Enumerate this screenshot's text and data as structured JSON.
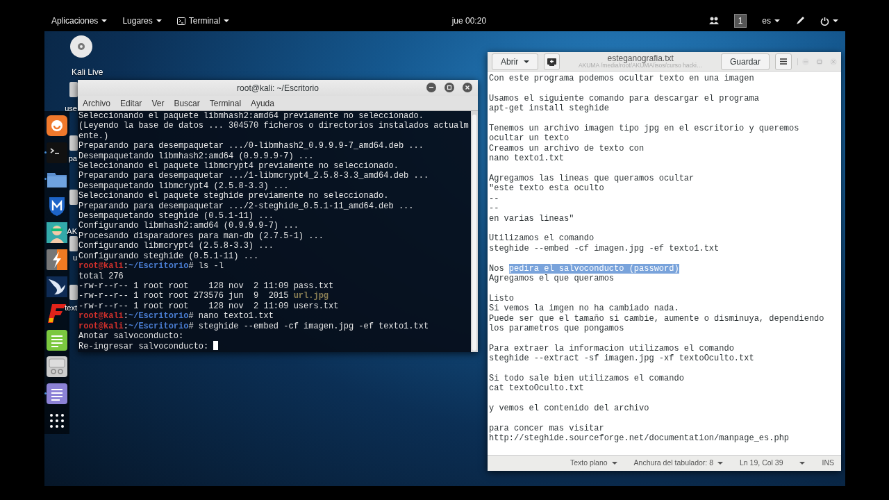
{
  "topbar": {
    "menus": [
      {
        "label": "Aplicaciones",
        "icon": false
      },
      {
        "label": "Lugares",
        "icon": false
      },
      {
        "label": "Terminal",
        "icon": true
      }
    ],
    "clock": "jue 00:20",
    "workspace": "1",
    "language": "es"
  },
  "desktop": {
    "icons": [
      {
        "label": "Kali Live"
      },
      {
        "label": "use"
      },
      {
        "label": "pa"
      },
      {
        "label": "AK"
      },
      {
        "label": "u"
      },
      {
        "label": "text"
      }
    ]
  },
  "dock": {
    "items": [
      {
        "running": false
      },
      {
        "running": true
      },
      {
        "running": true
      },
      {
        "running": false
      },
      {
        "running": false
      },
      {
        "running": false
      },
      {
        "running": false
      },
      {
        "running": false
      },
      {
        "running": false
      },
      {
        "running": false
      },
      {
        "running": true
      },
      {
        "running": false
      }
    ]
  },
  "terminal": {
    "title": "root@kali: ~/Escritorio",
    "active": true,
    "menu": [
      "Archivo",
      "Editar",
      "Ver",
      "Buscar",
      "Terminal",
      "Ayuda"
    ],
    "cursor": true,
    "lines": [
      {
        "kind": "output",
        "text": "Seleccionando el paquete libmhash2:amd64 previamente no seleccionado."
      },
      {
        "kind": "output",
        "text": "(Leyendo la base de datos ... 304570 ficheros o directorios instalados actualm"
      },
      {
        "kind": "output",
        "text": "ente.)"
      },
      {
        "kind": "output",
        "text": "Preparando para desempaquetar .../0-libmhash2_0.9.9.9-7_amd64.deb ..."
      },
      {
        "kind": "output",
        "text": "Desempaquetando libmhash2:amd64 (0.9.9.9-7) ..."
      },
      {
        "kind": "output",
        "text": "Seleccionando el paquete libmcrypt4 previamente no seleccionado."
      },
      {
        "kind": "output",
        "text": "Preparando para desempaquetar .../1-libmcrypt4_2.5.8-3.3_amd64.deb ..."
      },
      {
        "kind": "output",
        "text": "Desempaquetando libmcrypt4 (2.5.8-3.3) ..."
      },
      {
        "kind": "output",
        "text": "Seleccionando el paquete steghide previamente no seleccionado."
      },
      {
        "kind": "output",
        "text": "Preparando para desempaquetar .../2-steghide_0.5.1-11_amd64.deb ..."
      },
      {
        "kind": "output",
        "text": "Desempaquetando steghide (0.5.1-11) ..."
      },
      {
        "kind": "output",
        "text": "Configurando libmhash2:amd64 (0.9.9.9-7) ..."
      },
      {
        "kind": "output",
        "text": "Procesando disparadores para man-db (2.7.5-1) ..."
      },
      {
        "kind": "output",
        "text": "Configurando libmcrypt4 (2.5.8-3.3) ..."
      },
      {
        "kind": "output",
        "text": "Configurando steghide (0.5.1-11) ..."
      },
      {
        "kind": "prompt",
        "user": "root@kali",
        "separator": ":",
        "path": "~/Escritorio",
        "symbol": "#",
        "command": "ls -l"
      },
      {
        "kind": "output",
        "text": "total 276"
      },
      {
        "kind": "file",
        "text": "-rw-r--r-- 1 root root    128 nov  2 11:09 ",
        "file": "pass.txt",
        "highlighted": false
      },
      {
        "kind": "file",
        "text": "-rw-r--r-- 1 root root 273576 jun  9  2015 ",
        "file": "url.jpg",
        "highlighted": true
      },
      {
        "kind": "file",
        "text": "-rw-r--r-- 1 root root    128 nov  2 11:09 ",
        "file": "users.txt",
        "highlighted": false
      },
      {
        "kind": "prompt",
        "user": "root@kali",
        "separator": ":",
        "path": "~/Escritorio",
        "symbol": "#",
        "command": "nano texto1.txt"
      },
      {
        "kind": "prompt",
        "user": "root@kali",
        "separator": ":",
        "path": "~/Escritorio",
        "symbol": "#",
        "command": "steghide --embed -cf imagen.jpg -ef texto1.txt"
      },
      {
        "kind": "output",
        "text": "Anotar salvoconducto:"
      },
      {
        "kind": "output",
        "text": "Re-ingresar salvoconducto:"
      }
    ]
  },
  "editor": {
    "title": "esteganografia.txt",
    "subtitle": "AKUMA /media/root/AKUMA/isos/curso hacki…",
    "active": false,
    "open_button": "Abrir",
    "save_button": "Guardar",
    "paragraphs": [
      [
        "Con este programa podemos ocultar texto en una imagen"
      ],
      [
        "Usamos el siguiente comando para descargar el programa",
        "apt-get install steghide"
      ],
      [
        "Tenemos un archivo imagen tipo jpg en el escritorio y queremos",
        "ocultar un texto",
        "Creamos un archivo de texto con",
        "nano texto1.txt"
      ],
      [
        "Agregamos las lineas que queramos ocultar",
        "\"este texto esta oculto",
        "--",
        "--",
        "en varias lineas\""
      ],
      [
        "Utilizamos el comando",
        "steghide --embed -cf imagen.jpg -ef texto1.txt"
      ],
      [
        {
          "parts": [
            {
              "text": "Nos ",
              "selected": false
            },
            {
              "text": "pedira el salvoconducto (password)",
              "selected": true
            }
          ]
        },
        "Agregamos el que queramos"
      ],
      [
        "Listo",
        "Si vemos la imgen no ha cambiado nada.",
        "Puede ser que el tamaño si cambie, aumente o disminuya, dependiendo",
        "los parametros que pongamos"
      ],
      [
        "Para extraer la informacion utilizamos el comando",
        "steghide --extract -sf imagen.jpg -xf textoOculto.txt"
      ],
      [
        "Si todo sale bien utilizamos el comando",
        "cat textoOculto.txt"
      ],
      [
        "y vemos el contenido del archivo"
      ],
      [
        "para concer mas visitar",
        "http://steghide.sourceforge.net/documentation/manpage_es.php"
      ]
    ],
    "status_bar": {
      "language": "Texto plano",
      "tab_width": "Anchura del tabulador: 8",
      "position": "Ln 19, Col 39",
      "mode": "INS"
    }
  }
}
